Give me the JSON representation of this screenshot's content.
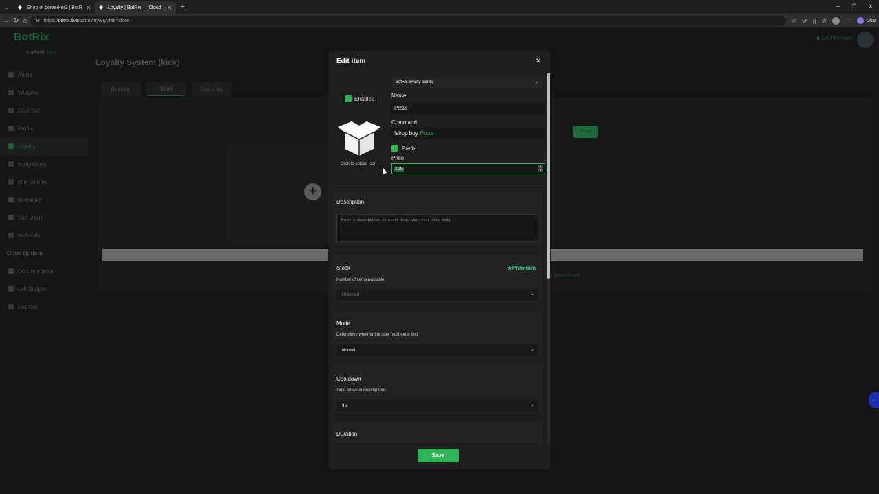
{
  "browser": {
    "tabs": [
      {
        "title": "Shop of berzerker3 | BotRix — Clo",
        "active": false
      },
      {
        "title": "Loyalty | BotRix — Cloud Streamin",
        "active": true
      }
    ],
    "url_prefix": "https://",
    "url_host": "botrix.live",
    "url_path": "/panel/loyalty?tab=store",
    "chat_label": "Chat"
  },
  "app": {
    "logo": "BotRix",
    "platform_label": "Platform:",
    "platform_value": "Kick",
    "go_premium": "Go Premium",
    "page_title": "Loyalty System (kick)",
    "tabs": [
      "Ranking",
      "Store",
      "Sales log"
    ],
    "copy_label": "Copy",
    "terms_label": "terms of use",
    "sidebar": {
      "items": [
        {
          "label": "Alerts",
          "icon": "bell-icon"
        },
        {
          "label": "Widgets",
          "icon": "widgets-icon"
        },
        {
          "label": "Chat Bot",
          "icon": "bot-icon"
        },
        {
          "label": "Profile",
          "icon": "user-icon"
        },
        {
          "label": "Loyalty",
          "icon": "loyalty-icon",
          "active": true
        },
        {
          "label": "Integrations",
          "icon": "integrations-icon"
        },
        {
          "label": "Mini Games",
          "icon": "gamepad-icon"
        },
        {
          "label": "Interaction",
          "icon": "music-icon"
        },
        {
          "label": "Sub Users",
          "icon": "users-icon"
        },
        {
          "label": "Referrals",
          "icon": "referrals-icon"
        }
      ],
      "other_heading": "Other Options",
      "other_items": [
        {
          "label": "Documentation",
          "icon": "doc-icon"
        },
        {
          "label": "Get Support",
          "icon": "support-icon"
        },
        {
          "label": "Log Out",
          "icon": "logout-icon"
        }
      ]
    }
  },
  "modal": {
    "title": "Edit item",
    "currency": "BotRix loyalty points",
    "enabled_label": "Enabled",
    "upload_label": "Click to upload icon",
    "name_label": "Name",
    "name_value": "Pizza",
    "command_label": "Command",
    "command_prefix": "!shop buy",
    "command_item": "Pizza",
    "prefix_label": "Prefix",
    "price_label": "Price",
    "price_value": "100",
    "description_label": "Description",
    "description_placeholder": "Enter a description so users know what this item does.",
    "stock_label": "Stock",
    "premium_label": "Premium",
    "stock_sub": "Number of items available",
    "stock_value": "Unlimited",
    "mode_label": "Mode",
    "mode_sub": "Determines whether the user must enter text",
    "mode_value": "Normal",
    "cooldown_label": "Cooldown",
    "cooldown_sub": "Time between redemptions",
    "cooldown_value": "3 s",
    "duration_label": "Duration",
    "save_label": "Save"
  },
  "colors": {
    "accent": "#2fb357",
    "premium": "#3ad38a"
  }
}
